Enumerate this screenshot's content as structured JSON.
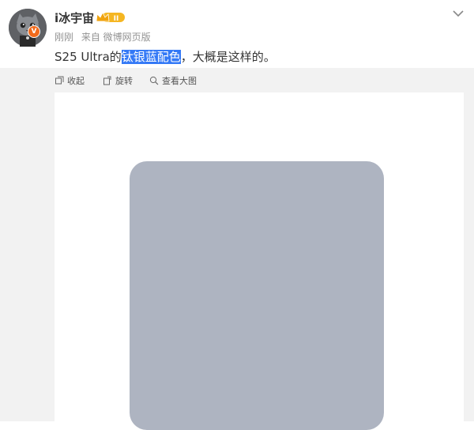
{
  "user": {
    "name": "i冰宇宙",
    "vip_level": "II",
    "verified_mark": "V"
  },
  "meta": {
    "time": "刚刚",
    "source": "来自 微博网页版"
  },
  "post": {
    "prefix": "S25 Ultra的",
    "highlight": "钛银蓝配色",
    "suffix": "，大概是这样的。"
  },
  "toolbar": {
    "collect": "收起",
    "rotate": "旋转",
    "view_large": "查看大图"
  },
  "colors": {
    "highlight": "#3479f6",
    "phone": "#aeb4c1",
    "badge": "#f26a1b"
  }
}
